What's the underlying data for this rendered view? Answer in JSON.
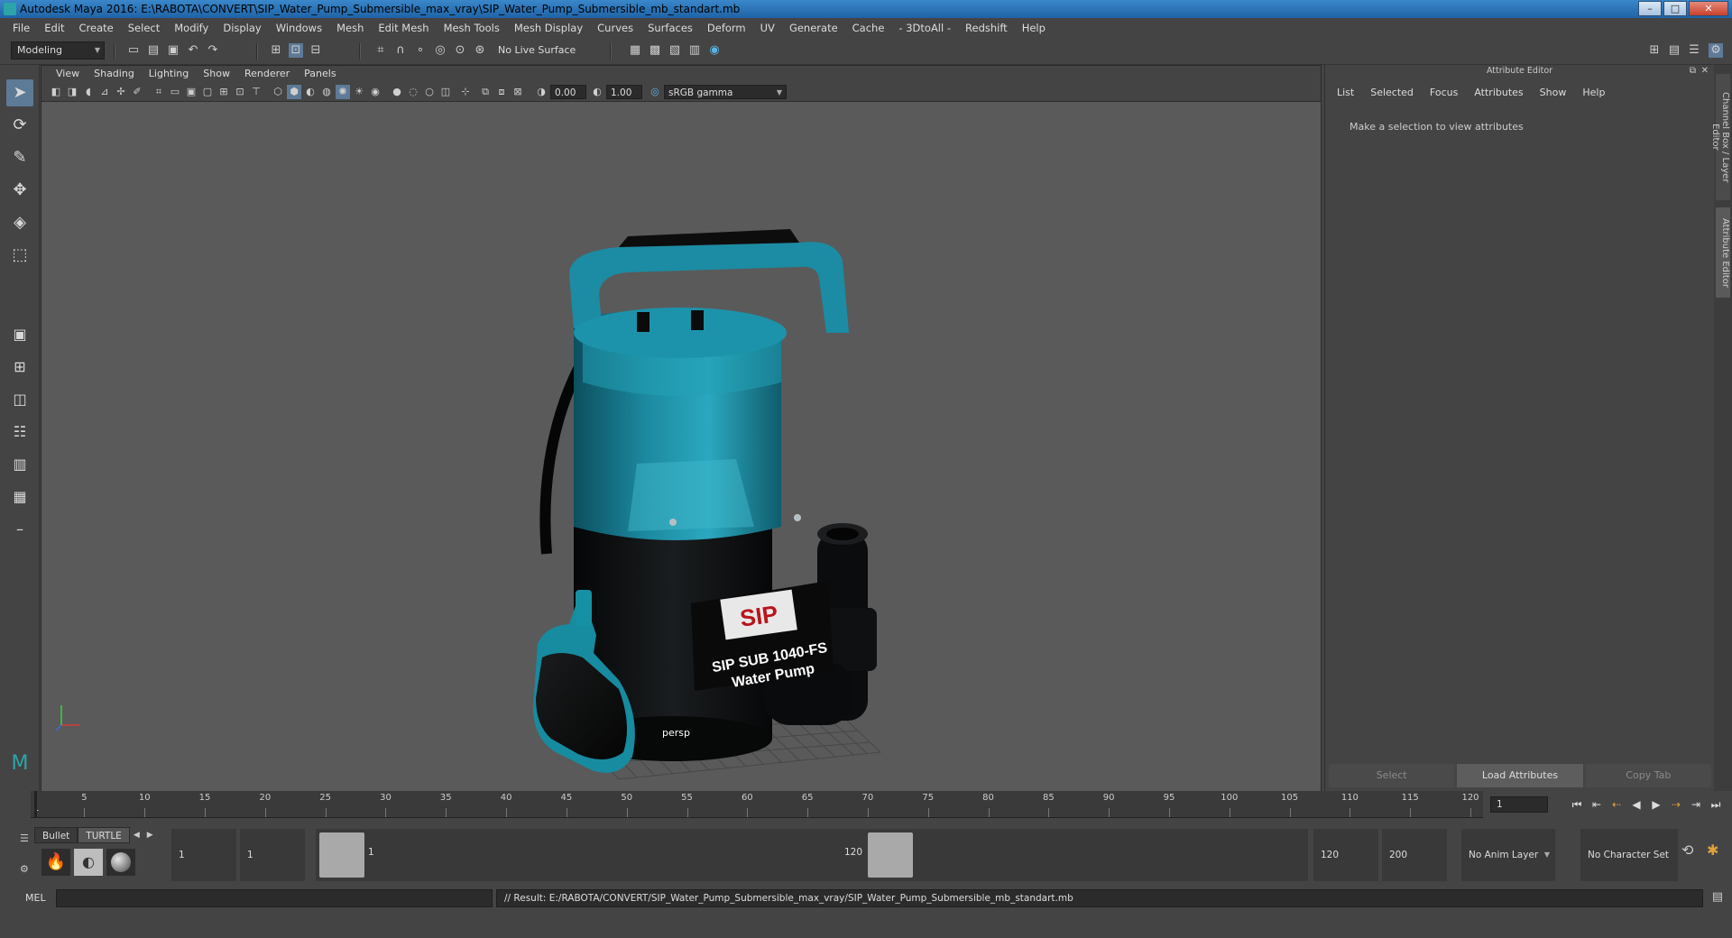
{
  "window": {
    "title": "Autodesk Maya 2016: E:\\RABOTA\\CONVERT\\SIP_Water_Pump_Submersible_max_vray\\SIP_Water_Pump_Submersible_mb_standart.mb",
    "minimize": "–",
    "maximize": "□",
    "close": "✕"
  },
  "menubar": [
    "File",
    "Edit",
    "Create",
    "Select",
    "Modify",
    "Display",
    "Windows",
    "Mesh",
    "Edit Mesh",
    "Mesh Tools",
    "Mesh Display",
    "Curves",
    "Surfaces",
    "Deform",
    "UV",
    "Generate",
    "Cache",
    "- 3DtoAll -",
    "Redshift",
    "Help"
  ],
  "shelf": {
    "mode": "Modeling",
    "live_surface": "No Live Surface"
  },
  "viewport": {
    "menu": [
      "View",
      "Shading",
      "Lighting",
      "Show",
      "Renderer",
      "Panels"
    ],
    "exposure": "0.00",
    "gamma": "1.00",
    "color_space": "sRGB gamma",
    "camera_label": "persp",
    "product": {
      "brand": "SIP",
      "model": "SIP SUB 1040-FS",
      "type": "Water Pump"
    },
    "colors": {
      "body_teal": "#1a7f94",
      "body_black": "#0b0d0e",
      "background": "#5a5a5a"
    }
  },
  "attribute_editor": {
    "title": "Attribute Editor",
    "menu": [
      "List",
      "Selected",
      "Focus",
      "Attributes",
      "Show",
      "Help"
    ],
    "message": "Make a selection to view attributes",
    "buttons": [
      "Select",
      "Load Attributes",
      "Copy Tab"
    ]
  },
  "side_tabs": [
    "Channel Box / Layer Editor",
    "Attribute Editor"
  ],
  "timeline": {
    "ticks": [
      "1",
      "5",
      "10",
      "15",
      "20",
      "25",
      "30",
      "35",
      "40",
      "45",
      "50",
      "55",
      "60",
      "65",
      "70",
      "75",
      "80",
      "85",
      "90",
      "95",
      "100",
      "105",
      "110",
      "115",
      "120"
    ],
    "current_frame": "1"
  },
  "range": {
    "shelf_tabs": [
      "Bullet",
      "TURTLE"
    ],
    "start_frame": "1",
    "playback_start": "1",
    "range_start_label": "1",
    "range_end_label": "120",
    "playback_end": "120",
    "end_frame": "200",
    "anim_layer": "No Anim Layer",
    "character_set": "No Character Set"
  },
  "command_line": {
    "label": "MEL",
    "result": "// Result: E:/RABOTA/CONVERT/SIP_Water_Pump_Submersible_max_vray/SIP_Water_Pump_Submersible_mb_standart.mb"
  },
  "icons": {
    "select_tool": "arrow-cursor-icon",
    "lasso_tool": "lasso-icon",
    "paint_tool": "paint-brush-icon",
    "move_tool": "move-icon",
    "rotate_tool": "rotate-icon",
    "scale_tool": "scale-icon"
  }
}
